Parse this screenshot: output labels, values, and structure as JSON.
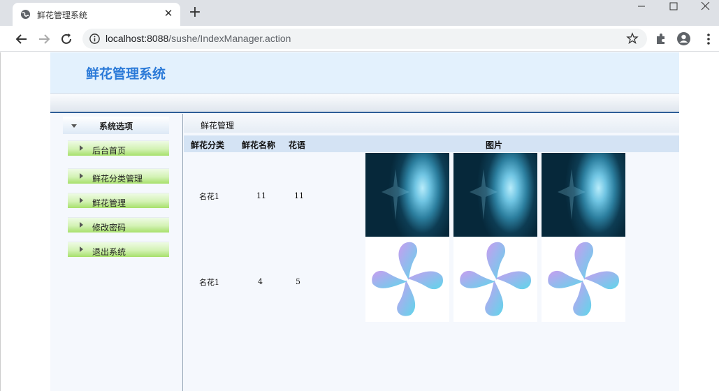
{
  "browser": {
    "tab_title": "鲜花管理系统",
    "url_host": "localhost:8088",
    "url_path": "/sushe/IndexManager.action"
  },
  "header": {
    "title": "鲜花管理系统"
  },
  "sidebar": {
    "heading": "系统选项",
    "items": [
      {
        "label": "后台首页"
      },
      {
        "label": "鲜花分类管理"
      },
      {
        "label": "鲜花管理"
      },
      {
        "label": "修改密码"
      },
      {
        "label": "退出系统"
      }
    ]
  },
  "content": {
    "title": "鲜花管理",
    "columns": [
      "鲜花分类",
      "鲜花名称",
      "花语",
      "图片"
    ],
    "rows": [
      {
        "category": "名花1",
        "name": "11",
        "language": "11",
        "images": [
          "dark-abstract-image",
          "dark-abstract-image",
          "dark-abstract-image"
        ]
      },
      {
        "category": "名花1",
        "name": "4",
        "language": "5",
        "images": [
          "pinwheel-image",
          "pinwheel-image",
          "pinwheel-image"
        ]
      }
    ]
  },
  "colors": {
    "header_bg": "#e3f1fd",
    "title_blue": "#2b7ad8",
    "nav_green": "#a7e06b",
    "divider_navy": "#2d5d97",
    "table_header_bg": "#d4e3f4"
  }
}
